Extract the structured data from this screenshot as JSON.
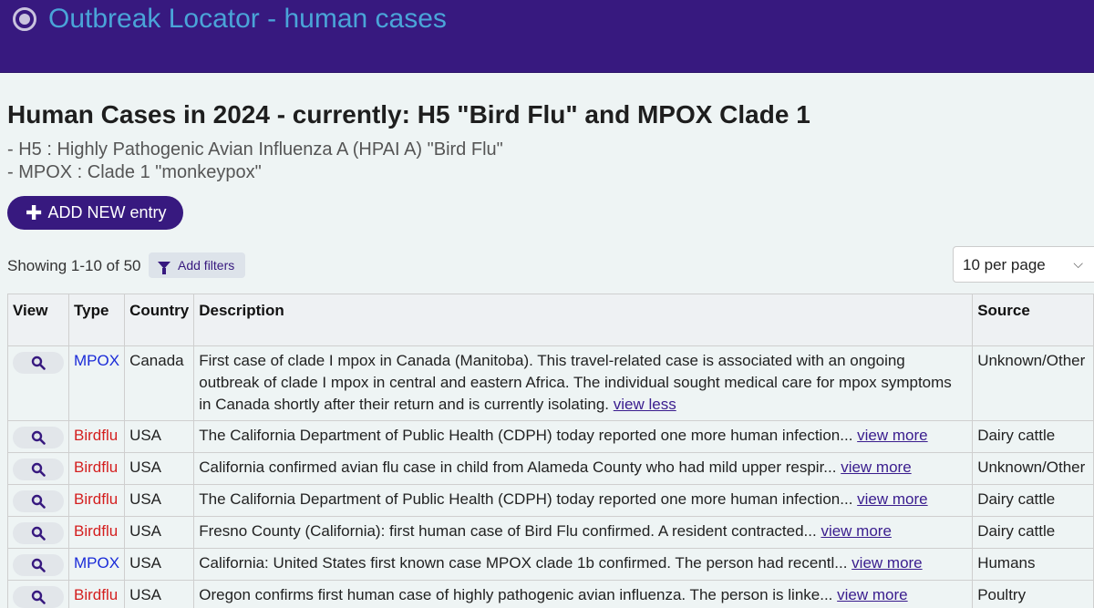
{
  "header": {
    "title": "Outbreak Locator - human cases",
    "logo_icon": "target-icon"
  },
  "page": {
    "heading": "Human Cases in 2024 - currently: H5 \"Bird Flu\" and MPOX Clade 1",
    "subtitle_1": "- H5 : Highly Pathogenic Avian Influenza A (HPAI A) \"Bird Flu\"",
    "subtitle_2": "- MPOX : Clade 1 \"monkeypox\""
  },
  "toolbar": {
    "add_label": "ADD NEW entry",
    "showing": "Showing 1-10 of 50",
    "filters_label": "Add filters",
    "per_page": "10 per page"
  },
  "table": {
    "columns": [
      "View",
      "Type",
      "Country",
      "Description",
      "Source"
    ],
    "rows": [
      {
        "type": "MPOX",
        "country": "Canada",
        "description": "First case of clade I mpox in Canada (Manitoba). This travel-related case is associated with an ongoing outbreak of clade I mpox in central and eastern Africa. The individual sought medical care for mpox symptoms in Canada shortly after their return and is currently isolating.",
        "link": "view less",
        "source": "Unknown/Other"
      },
      {
        "type": "Birdflu",
        "country": "USA",
        "description": "The California Department of Public Health (CDPH) today reported one more human infection...",
        "link": "view more",
        "source": "Dairy cattle"
      },
      {
        "type": "Birdflu",
        "country": "USA",
        "description": "California confirmed avian flu case in child from Alameda County who had mild upper respir...",
        "link": "view more",
        "source": "Unknown/Other"
      },
      {
        "type": "Birdflu",
        "country": "USA",
        "description": "The California Department of Public Health (CDPH) today reported one more human infection...",
        "link": "view more",
        "source": "Dairy cattle"
      },
      {
        "type": "Birdflu",
        "country": "USA",
        "description": "Fresno County (California): first human case of Bird Flu confirmed. A resident contracted...",
        "link": "view more",
        "source": "Dairy cattle"
      },
      {
        "type": "MPOX",
        "country": "USA",
        "description": "California: United States first known case MPOX clade 1b confirmed. The person had recentl...",
        "link": "view more",
        "source": "Humans"
      },
      {
        "type": "Birdflu",
        "country": "USA",
        "description": "Oregon confirms first human case of highly pathogenic avian influenza. The person is linke...",
        "link": "view more",
        "source": "Poultry"
      }
    ]
  },
  "colors": {
    "topbar": "#37197f",
    "title": "#4aa4d8",
    "mpox": "#1a2bd8",
    "birdflu": "#d41f1f",
    "link": "#3a1d8e"
  }
}
